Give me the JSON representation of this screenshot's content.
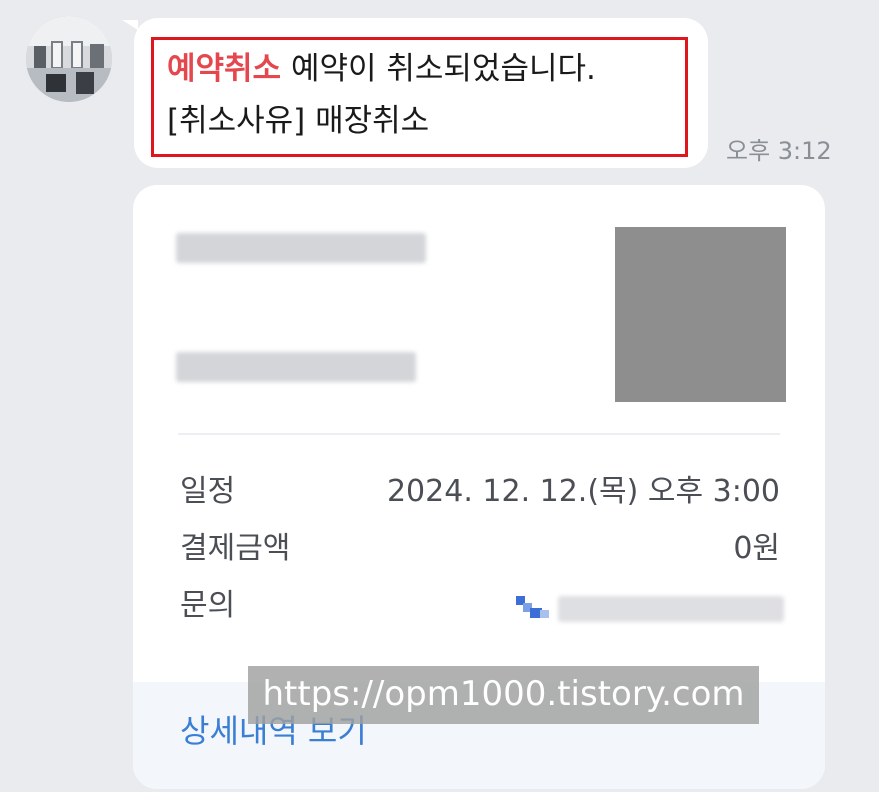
{
  "message": {
    "status_label": "예약취소",
    "line1_text": " 예약이 취소되었습니다.",
    "line2_text": "[취소사유] 매장취소",
    "time": "오후 3:12"
  },
  "card": {
    "rows": [
      {
        "label": "일정",
        "value": "2024. 12. 12.(목) 오후 3:00"
      },
      {
        "label": "결제금액",
        "value": "0원"
      },
      {
        "label": "문의",
        "value": ""
      }
    ],
    "detail_link": "상세내역 보기"
  },
  "watermark": "https://opm1000.tistory.com",
  "colors": {
    "highlight_border": "#e0161e",
    "status_text": "#e5474f",
    "link": "#3a7fd4"
  },
  "icons": {
    "phone": "phone-icon"
  }
}
